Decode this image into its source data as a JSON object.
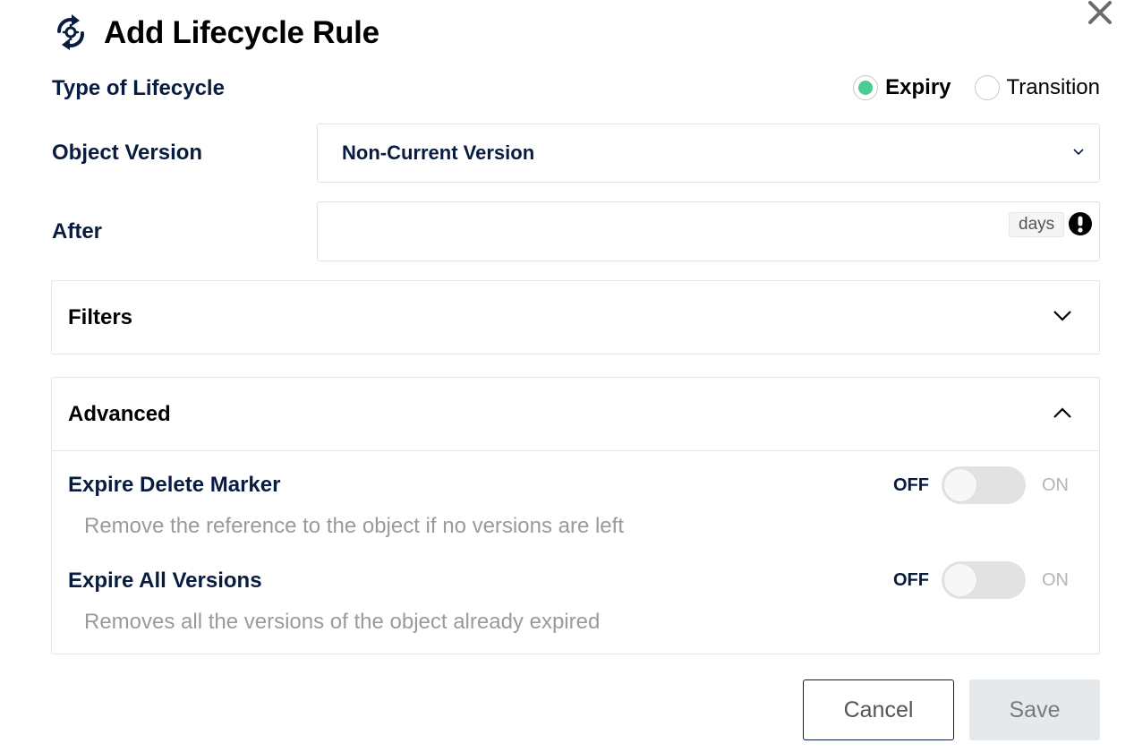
{
  "modal": {
    "title": "Add Lifecycle Rule",
    "title_icon": "lifecycle-refresh-gear-icon",
    "close_icon": "close-icon"
  },
  "lifecycle_type": {
    "label": "Type of Lifecycle",
    "options": [
      {
        "label": "Expiry",
        "selected": true
      },
      {
        "label": "Transition",
        "selected": false
      }
    ],
    "selected_color": "#4ccb92"
  },
  "object_version": {
    "label": "Object Version",
    "selected": "Non-Current Version",
    "icon": "chevron-down-icon"
  },
  "after": {
    "label": "After",
    "value": "",
    "unit": "days",
    "status_icon": "exclamation-circle-icon"
  },
  "filters": {
    "title": "Filters",
    "expanded": false
  },
  "advanced": {
    "title": "Advanced",
    "expanded": true,
    "options": [
      {
        "title": "Expire Delete Marker",
        "description": "Remove the reference to the object if no versions are left",
        "off_label": "OFF",
        "on_label": "ON",
        "enabled": false
      },
      {
        "title": "Expire All Versions",
        "description": "Removes all the versions of the object already expired",
        "off_label": "OFF",
        "on_label": "ON",
        "enabled": false
      }
    ]
  },
  "actions": {
    "cancel": "Cancel",
    "save": "Save"
  },
  "colors": {
    "text_primary": "#081c42",
    "accent_green": "#4ccb92",
    "muted_text": "#9a9a9a"
  }
}
